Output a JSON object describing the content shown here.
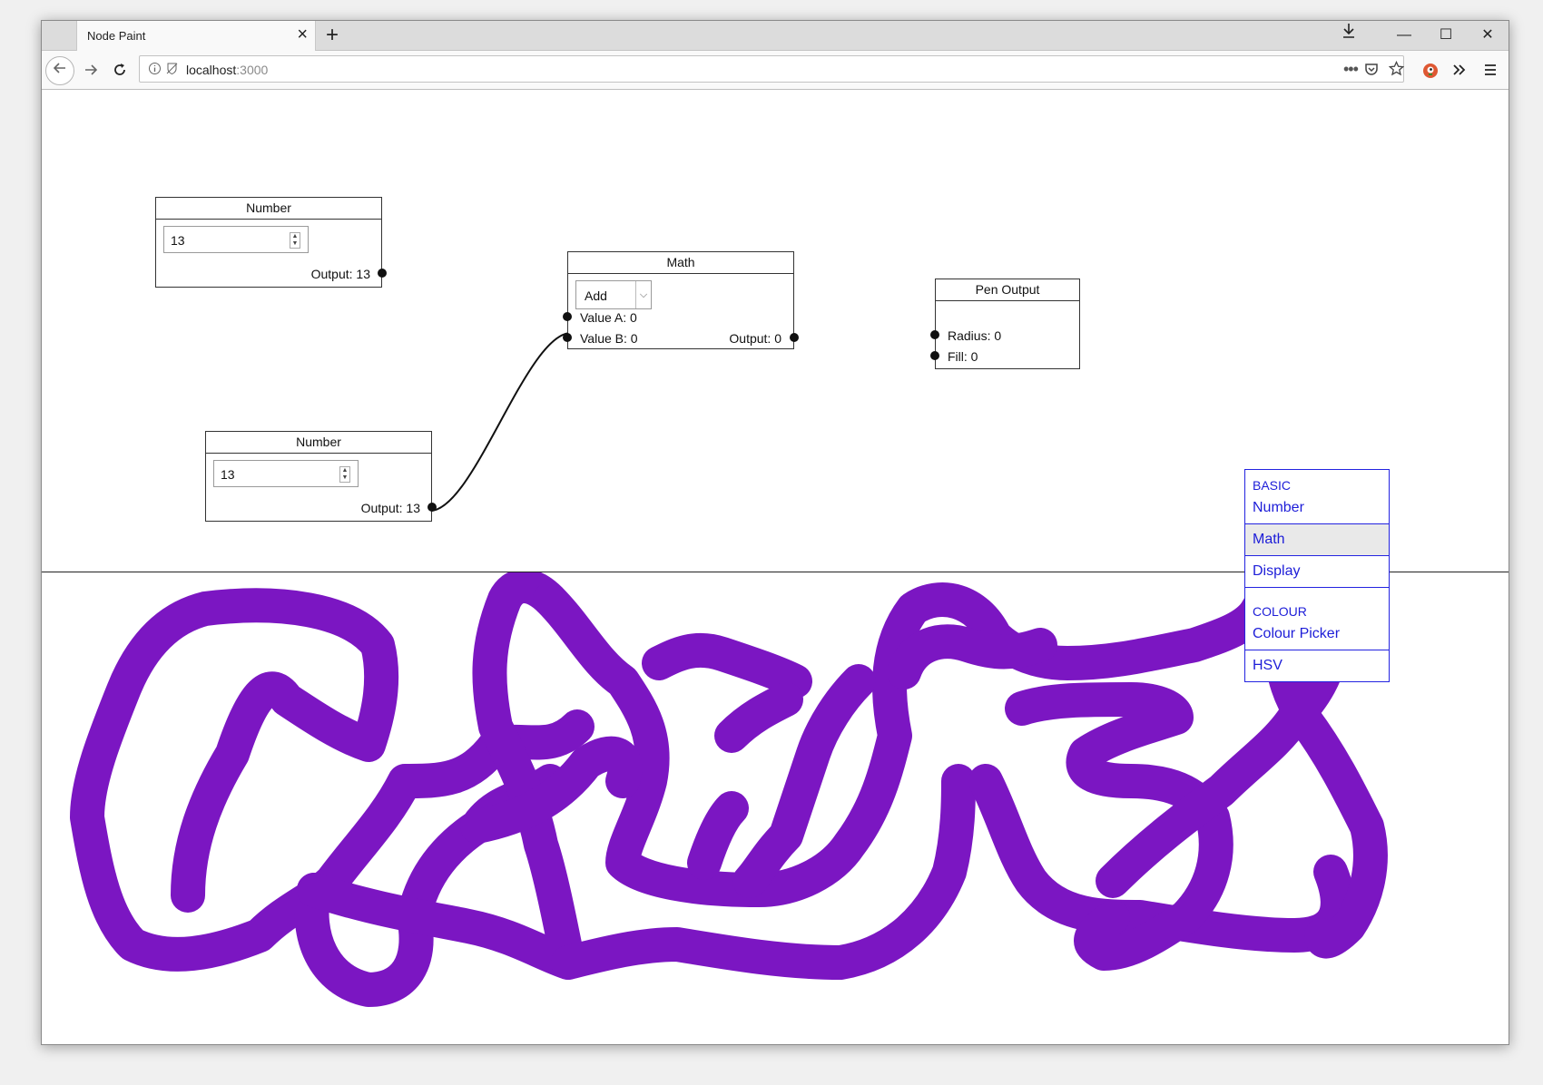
{
  "browser": {
    "tab_title": "Node Paint",
    "tab_close": "×",
    "new_tab": "+",
    "url_host": "localhost",
    "url_port": ":3000",
    "controls": {
      "minimize": "—",
      "maximize": "☐",
      "close": "✕"
    }
  },
  "nodes": {
    "number1": {
      "title": "Number",
      "value": "13",
      "output_label": "Output: 13"
    },
    "number2": {
      "title": "Number",
      "value": "13",
      "output_label": "Output: 13"
    },
    "math": {
      "title": "Math",
      "operation": "Add",
      "value_a": "Value A: 0",
      "value_b": "Value B: 0",
      "output_label": "Output: 0"
    },
    "pen_output": {
      "title": "Pen Output",
      "radius": "Radius: 0",
      "fill": "Fill: 0"
    }
  },
  "context_menu": {
    "basic_header": "BASIC",
    "number": "Number",
    "math": "Math",
    "display": "Display",
    "colour_header": "COLOUR",
    "colour_picker": "Colour Picker",
    "hsv": "HSV"
  },
  "canvas": {
    "stroke_color": "#7b16c2"
  },
  "icons": [
    "back-icon",
    "forward-icon",
    "reload-icon",
    "info-icon",
    "tracking-icon",
    "downloads-icon",
    "more-icon",
    "pocket-icon",
    "bookmark-star-icon",
    "duckduckgo-icon",
    "overflow-icon",
    "hamburger-menu-icon"
  ]
}
